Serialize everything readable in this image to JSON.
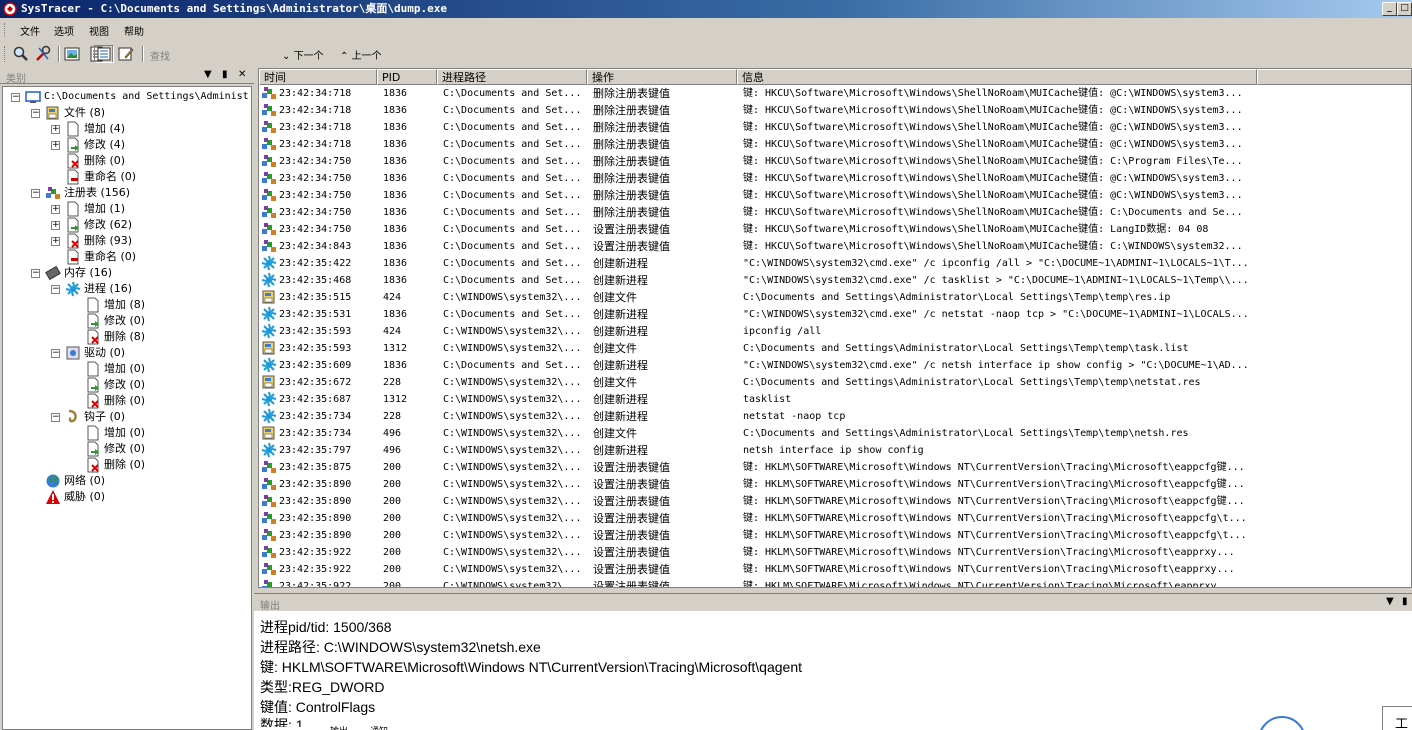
{
  "window": {
    "title": "SysTracer - C:\\Documents and Settings\\Administrator\\桌面\\dump.exe",
    "min": "_",
    "max": "□"
  },
  "menu": [
    "文件",
    "选项",
    "视图",
    "帮助"
  ],
  "toolbar": {
    "find_label": "查找",
    "next": "下一个",
    "prev": "上一个"
  },
  "left_pane": {
    "title": "类别",
    "buttons": [
      "▼",
      "ᵖ",
      "✕"
    ],
    "tree": [
      {
        "label": "C:\\Documents and Settings\\Administ",
        "level": 0,
        "expander": "−",
        "icon": "computer"
      },
      {
        "label": "文件 (8)",
        "level": 1,
        "expander": "−",
        "icon": "file"
      },
      {
        "label": "增加 (4)",
        "level": 2,
        "expander": "+",
        "icon": "doc"
      },
      {
        "label": "修改 (4)",
        "level": 2,
        "expander": "+",
        "icon": "doc-modify"
      },
      {
        "label": "删除 (0)",
        "level": 2,
        "expander": "",
        "icon": "doc-delete"
      },
      {
        "label": "重命名 (0)",
        "level": 2,
        "expander": "",
        "icon": "doc-rename"
      },
      {
        "label": "注册表 (156)",
        "level": 1,
        "expander": "−",
        "icon": "registry"
      },
      {
        "label": "增加 (1)",
        "level": 2,
        "expander": "+",
        "icon": "doc"
      },
      {
        "label": "修改 (62)",
        "level": 2,
        "expander": "+",
        "icon": "doc-modify"
      },
      {
        "label": "删除 (93)",
        "level": 2,
        "expander": "+",
        "icon": "doc-delete"
      },
      {
        "label": "重命名 (0)",
        "level": 2,
        "expander": "",
        "icon": "doc-rename"
      },
      {
        "label": "内存 (16)",
        "level": 1,
        "expander": "−",
        "icon": "memory"
      },
      {
        "label": "进程 (16)",
        "level": 2,
        "expander": "−",
        "icon": "process"
      },
      {
        "label": "增加 (8)",
        "level": 3,
        "expander": "",
        "icon": "doc"
      },
      {
        "label": "修改 (0)",
        "level": 3,
        "expander": "",
        "icon": "doc-modify"
      },
      {
        "label": "删除 (8)",
        "level": 3,
        "expander": "",
        "icon": "doc-delete"
      },
      {
        "label": "驱动 (0)",
        "level": 2,
        "expander": "−",
        "icon": "driver"
      },
      {
        "label": "增加 (0)",
        "level": 3,
        "expander": "",
        "icon": "doc"
      },
      {
        "label": "修改 (0)",
        "level": 3,
        "expander": "",
        "icon": "doc-modify"
      },
      {
        "label": "删除 (0)",
        "level": 3,
        "expander": "",
        "icon": "doc-delete"
      },
      {
        "label": "钩子 (0)",
        "level": 2,
        "expander": "−",
        "icon": "hook"
      },
      {
        "label": "增加 (0)",
        "level": 3,
        "expander": "",
        "icon": "doc"
      },
      {
        "label": "修改 (0)",
        "level": 3,
        "expander": "",
        "icon": "doc-modify"
      },
      {
        "label": "删除 (0)",
        "level": 3,
        "expander": "",
        "icon": "doc-delete"
      },
      {
        "label": "网络 (0)",
        "level": 1,
        "expander": "",
        "icon": "globe"
      },
      {
        "label": "威胁 (0)",
        "level": 1,
        "expander": "",
        "icon": "warning"
      }
    ]
  },
  "list": {
    "columns": [
      "时间",
      "PID",
      "进程路径",
      "操作",
      "信息"
    ],
    "rows": [
      {
        "icon": "registry",
        "time": "23:42:34:718",
        "pid": "1836",
        "path": "C:\\Documents and Set...",
        "op": "删除注册表键值",
        "info": "键: HKCU\\Software\\Microsoft\\Windows\\ShellNoRoam\\MUICache键值: @C:\\WINDOWS\\system3..."
      },
      {
        "icon": "registry",
        "time": "23:42:34:718",
        "pid": "1836",
        "path": "C:\\Documents and Set...",
        "op": "删除注册表键值",
        "info": "键: HKCU\\Software\\Microsoft\\Windows\\ShellNoRoam\\MUICache键值: @C:\\WINDOWS\\system3..."
      },
      {
        "icon": "registry",
        "time": "23:42:34:718",
        "pid": "1836",
        "path": "C:\\Documents and Set...",
        "op": "删除注册表键值",
        "info": "键: HKCU\\Software\\Microsoft\\Windows\\ShellNoRoam\\MUICache键值: @C:\\WINDOWS\\system3..."
      },
      {
        "icon": "registry",
        "time": "23:42:34:718",
        "pid": "1836",
        "path": "C:\\Documents and Set...",
        "op": "删除注册表键值",
        "info": "键: HKCU\\Software\\Microsoft\\Windows\\ShellNoRoam\\MUICache键值: @C:\\WINDOWS\\system3..."
      },
      {
        "icon": "registry",
        "time": "23:42:34:750",
        "pid": "1836",
        "path": "C:\\Documents and Set...",
        "op": "删除注册表键值",
        "info": "键: HKCU\\Software\\Microsoft\\Windows\\ShellNoRoam\\MUICache键值: C:\\Program Files\\Te..."
      },
      {
        "icon": "registry",
        "time": "23:42:34:750",
        "pid": "1836",
        "path": "C:\\Documents and Set...",
        "op": "删除注册表键值",
        "info": "键: HKCU\\Software\\Microsoft\\Windows\\ShellNoRoam\\MUICache键值: @C:\\WINDOWS\\system3..."
      },
      {
        "icon": "registry",
        "time": "23:42:34:750",
        "pid": "1836",
        "path": "C:\\Documents and Set...",
        "op": "删除注册表键值",
        "info": "键: HKCU\\Software\\Microsoft\\Windows\\ShellNoRoam\\MUICache键值: @C:\\WINDOWS\\system3..."
      },
      {
        "icon": "registry",
        "time": "23:42:34:750",
        "pid": "1836",
        "path": "C:\\Documents and Set...",
        "op": "删除注册表键值",
        "info": "键: HKCU\\Software\\Microsoft\\Windows\\ShellNoRoam\\MUICache键值: C:\\Documents and Se..."
      },
      {
        "icon": "registry",
        "time": "23:42:34:750",
        "pid": "1836",
        "path": "C:\\Documents and Set...",
        "op": "设置注册表键值",
        "info": "键: HKCU\\Software\\Microsoft\\Windows\\ShellNoRoam\\MUICache键值: LangID数据: 04 08"
      },
      {
        "icon": "registry",
        "time": "23:42:34:843",
        "pid": "1836",
        "path": "C:\\Documents and Set...",
        "op": "设置注册表键值",
        "info": "键: HKCU\\Software\\Microsoft\\Windows\\ShellNoRoam\\MUICache键值: C:\\WINDOWS\\system32..."
      },
      {
        "icon": "process",
        "time": "23:42:35:422",
        "pid": "1836",
        "path": "C:\\Documents and Set...",
        "op": "创建新进程",
        "info": "\"C:\\WINDOWS\\system32\\cmd.exe\" /c ipconfig /all > \"C:\\DOCUME~1\\ADMINI~1\\LOCALS~1\\T..."
      },
      {
        "icon": "process",
        "time": "23:42:35:468",
        "pid": "1836",
        "path": "C:\\Documents and Set...",
        "op": "创建新进程",
        "info": "\"C:\\WINDOWS\\system32\\cmd.exe\" /c tasklist > \"C:\\DOCUME~1\\ADMINI~1\\LOCALS~1\\Temp\\\\..."
      },
      {
        "icon": "file",
        "time": "23:42:35:515",
        "pid": "424",
        "path": "C:\\WINDOWS\\system32\\...",
        "op": "创建文件",
        "info": "C:\\Documents and Settings\\Administrator\\Local Settings\\Temp\\temp\\res.ip"
      },
      {
        "icon": "process",
        "time": "23:42:35:531",
        "pid": "1836",
        "path": "C:\\Documents and Set...",
        "op": "创建新进程",
        "info": "\"C:\\WINDOWS\\system32\\cmd.exe\" /c netstat -naop tcp > \"C:\\DOCUME~1\\ADMINI~1\\LOCALS..."
      },
      {
        "icon": "process",
        "time": "23:42:35:593",
        "pid": "424",
        "path": "C:\\WINDOWS\\system32\\...",
        "op": "创建新进程",
        "info": "ipconfig /all"
      },
      {
        "icon": "file",
        "time": "23:42:35:593",
        "pid": "1312",
        "path": "C:\\WINDOWS\\system32\\...",
        "op": "创建文件",
        "info": "C:\\Documents and Settings\\Administrator\\Local Settings\\Temp\\temp\\task.list"
      },
      {
        "icon": "process",
        "time": "23:42:35:609",
        "pid": "1836",
        "path": "C:\\Documents and Set...",
        "op": "创建新进程",
        "info": "\"C:\\WINDOWS\\system32\\cmd.exe\" /c netsh interface ip show config > \"C:\\DOCUME~1\\AD..."
      },
      {
        "icon": "file",
        "time": "23:42:35:672",
        "pid": "228",
        "path": "C:\\WINDOWS\\system32\\...",
        "op": "创建文件",
        "info": "C:\\Documents and Settings\\Administrator\\Local Settings\\Temp\\temp\\netstat.res"
      },
      {
        "icon": "process",
        "time": "23:42:35:687",
        "pid": "1312",
        "path": "C:\\WINDOWS\\system32\\...",
        "op": "创建新进程",
        "info": "tasklist"
      },
      {
        "icon": "process",
        "time": "23:42:35:734",
        "pid": "228",
        "path": "C:\\WINDOWS\\system32\\...",
        "op": "创建新进程",
        "info": "netstat -naop tcp"
      },
      {
        "icon": "file",
        "time": "23:42:35:734",
        "pid": "496",
        "path": "C:\\WINDOWS\\system32\\...",
        "op": "创建文件",
        "info": "C:\\Documents and Settings\\Administrator\\Local Settings\\Temp\\temp\\netsh.res"
      },
      {
        "icon": "process",
        "time": "23:42:35:797",
        "pid": "496",
        "path": "C:\\WINDOWS\\system32\\...",
        "op": "创建新进程",
        "info": "netsh interface ip show config"
      },
      {
        "icon": "registry",
        "time": "23:42:35:875",
        "pid": "200",
        "path": "C:\\WINDOWS\\system32\\...",
        "op": "设置注册表键值",
        "info": "键: HKLM\\SOFTWARE\\Microsoft\\Windows NT\\CurrentVersion\\Tracing\\Microsoft\\eappcfg键..."
      },
      {
        "icon": "registry",
        "time": "23:42:35:890",
        "pid": "200",
        "path": "C:\\WINDOWS\\system32\\...",
        "op": "设置注册表键值",
        "info": "键: HKLM\\SOFTWARE\\Microsoft\\Windows NT\\CurrentVersion\\Tracing\\Microsoft\\eappcfg键..."
      },
      {
        "icon": "registry",
        "time": "23:42:35:890",
        "pid": "200",
        "path": "C:\\WINDOWS\\system32\\...",
        "op": "设置注册表键值",
        "info": "键: HKLM\\SOFTWARE\\Microsoft\\Windows NT\\CurrentVersion\\Tracing\\Microsoft\\eappcfg键..."
      },
      {
        "icon": "registry",
        "time": "23:42:35:890",
        "pid": "200",
        "path": "C:\\WINDOWS\\system32\\...",
        "op": "设置注册表键值",
        "info": "键: HKLM\\SOFTWARE\\Microsoft\\Windows NT\\CurrentVersion\\Tracing\\Microsoft\\eappcfg\\t..."
      },
      {
        "icon": "registry",
        "time": "23:42:35:890",
        "pid": "200",
        "path": "C:\\WINDOWS\\system32\\...",
        "op": "设置注册表键值",
        "info": "键: HKLM\\SOFTWARE\\Microsoft\\Windows NT\\CurrentVersion\\Tracing\\Microsoft\\eappcfg\\t..."
      },
      {
        "icon": "registry",
        "time": "23:42:35:922",
        "pid": "200",
        "path": "C:\\WINDOWS\\system32\\...",
        "op": "设置注册表键值",
        "info": "键: HKLM\\SOFTWARE\\Microsoft\\Windows NT\\CurrentVersion\\Tracing\\Microsoft\\eapprxy..."
      },
      {
        "icon": "registry",
        "time": "23:42:35:922",
        "pid": "200",
        "path": "C:\\WINDOWS\\system32\\...",
        "op": "设置注册表键值",
        "info": "键: HKLM\\SOFTWARE\\Microsoft\\Windows NT\\CurrentVersion\\Tracing\\Microsoft\\eapprxy..."
      },
      {
        "icon": "registry",
        "time": "23:42:35:922",
        "pid": "200",
        "path": "C:\\WINDOWS\\system32\\...",
        "op": "设置注册表键值",
        "info": "键: HKLM\\SOFTWARE\\Microsoft\\Windows NT\\CurrentVersion\\Tracing\\Microsoft\\eapprxy..."
      }
    ]
  },
  "output": {
    "title": "输出",
    "lines": [
      "进程pid/tid: 1500/368",
      "进程路径: C:\\WINDOWS\\system32\\netsh.exe",
      "键: HKLM\\SOFTWARE\\Microsoft\\Windows NT\\CurrentVersion\\Tracing\\Microsoft\\qagent",
      "类型:REG_DWORD",
      "键值: ControlFlags",
      "数据: 1"
    ],
    "tabs": [
      "输出",
      "通知"
    ]
  },
  "tooltip_text": "工具"
}
